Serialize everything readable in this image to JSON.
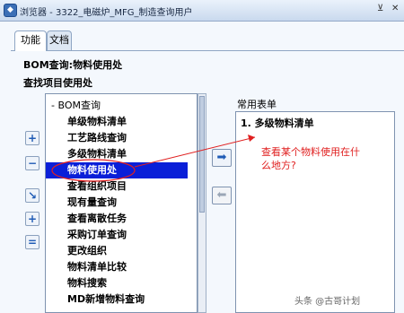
{
  "window": {
    "title": "浏览器 - 3322_电磁炉_MFG_制造查询用户",
    "close_glyph": "✕"
  },
  "tabs": [
    {
      "label": "功能",
      "active": true
    },
    {
      "label": "文档",
      "active": false
    }
  ],
  "page": {
    "title": "BOM查询:物料使用处",
    "find_label": "查找项目使用处"
  },
  "tree": {
    "root": "- BOM查询",
    "items": [
      "单级物料清单",
      "工艺路线查询",
      "多级物料清单",
      "物料使用处",
      "查看组织项目",
      "现有量查询",
      "查看离散任务",
      "采购订单查询",
      "更改组织",
      "物料清单比较",
      "物料搜索",
      "MD新增物料查询"
    ],
    "selected": "物料使用处"
  },
  "side_buttons": [
    {
      "name": "expand-icon",
      "glyph": "+"
    },
    {
      "name": "collapse-icon",
      "glyph": "−"
    },
    {
      "name": "expand-all-icon",
      "glyph": "↘"
    },
    {
      "name": "expand-branch-icon",
      "glyph": "+"
    },
    {
      "name": "collapse-all-icon",
      "glyph": "="
    }
  ],
  "favorites": {
    "label": "常用表单",
    "items": [
      "1. 多级物料清单"
    ]
  },
  "annotation": {
    "text": "查看某个物料使用在什么地方?",
    "color": "#e02020"
  },
  "watermark": "头条 @古哥计划",
  "colors": {
    "selection": "#0a1fd8",
    "accent": "#1f5bb5"
  }
}
